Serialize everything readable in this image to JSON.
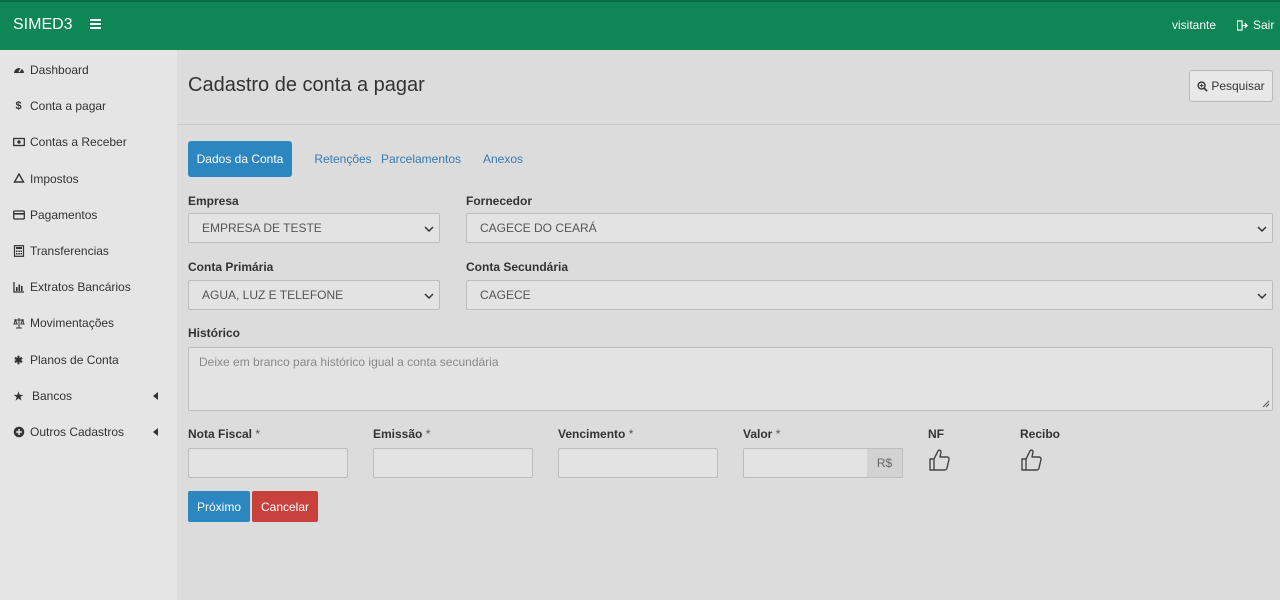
{
  "navbar": {
    "brand": "SIMED3",
    "user": "visitante",
    "logout_label": "Sair"
  },
  "sidebar": {
    "items": [
      {
        "label": "Dashboard",
        "icon": "dashboard-icon"
      },
      {
        "label": "Conta a pagar",
        "icon": "dollar-icon"
      },
      {
        "label": "Contas a Receber",
        "icon": "money-icon"
      },
      {
        "label": "Impostos",
        "icon": "recycle-icon"
      },
      {
        "label": "Pagamentos",
        "icon": "credit-card-icon"
      },
      {
        "label": "Transferencias",
        "icon": "calculator-icon"
      },
      {
        "label": "Extratos Bancários",
        "icon": "bar-chart-icon"
      },
      {
        "label": "Movimentações",
        "icon": "balance-scale-icon"
      },
      {
        "label": "Planos de Conta",
        "icon": "asterisk-icon"
      },
      {
        "label": "Bancos",
        "icon": "star-icon"
      },
      {
        "label": "Outros Cadastros",
        "icon": "plus-circle-icon"
      }
    ]
  },
  "page": {
    "title": "Cadastro de conta a pagar",
    "search_label": "Pesquisar"
  },
  "tabs": [
    "Dados da Conta",
    "Retenções",
    "Parcelamentos",
    "Anexos"
  ],
  "form": {
    "empresa": {
      "label": "Empresa",
      "value": "EMPRESA DE TESTE"
    },
    "fornecedor": {
      "label": "Fornecedor",
      "value": "CAGECE DO CEARÁ"
    },
    "conta_primaria": {
      "label": "Conta Primária",
      "value": "AGUA, LUZ E TELEFONE"
    },
    "conta_secundaria": {
      "label": "Conta Secundária",
      "value": "CAGECE"
    },
    "historico": {
      "label": "Histórico",
      "placeholder": "Deixe em branco para histórico igual a conta secundária"
    },
    "nota_fiscal": {
      "label": "Nota Fiscal",
      "required": "*",
      "value": ""
    },
    "emissao": {
      "label": "Emissão",
      "required": "*",
      "value": ""
    },
    "vencimento": {
      "label": "Vencimento",
      "required": "*",
      "value": ""
    },
    "valor": {
      "label": "Valor",
      "required": "*",
      "addon": "R$",
      "value": ""
    },
    "nf": {
      "label": "NF"
    },
    "recibo": {
      "label": "Recibo"
    }
  },
  "buttons": {
    "next": "Próximo",
    "cancel": "Cancelar"
  },
  "colors": {
    "navbar": "#0e8656",
    "primary": "#2c86c0",
    "danger": "#c9413c"
  }
}
